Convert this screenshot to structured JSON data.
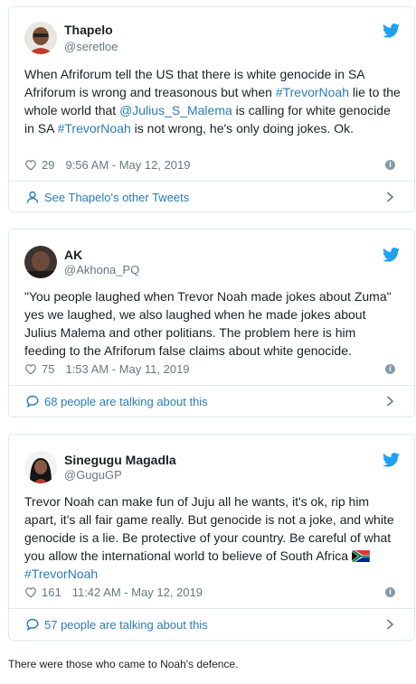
{
  "tweets": [
    {
      "name": "Thapelo",
      "handle": "@seretloe",
      "text_parts": {
        "p1": "When Afriforum tell the US that there is white genocide in SA Afriforum is wrong and treasonous but when ",
        "t1": "#TrevorNoah",
        "p2": " lie to the whole world that ",
        "t2": "@Julius_S_Malema",
        "p3": " is calling for white genocide in SA ",
        "t3": "#TrevorNoah",
        "p4": " is not wrong, he's only doing jokes. Ok."
      },
      "likes": "29",
      "timestamp": "9:56 AM - May 12, 2019",
      "footer": "See Thapelo's other Tweets"
    },
    {
      "name": "AK",
      "handle": "@Akhona_PQ",
      "text": "\"You people laughed  when Trevor Noah made jokes about Zuma\" yes we laughed, we also laughed when he made jokes about Julius Malema and other politians. The problem here is him feeding to the Afriforum false claims about white genocide.",
      "likes": "75",
      "timestamp": "1:53 AM - May 11, 2019",
      "footer": "68 people are talking about this"
    },
    {
      "name": "Sinegugu Magadla",
      "handle": "@GuguGP",
      "text_parts": {
        "p1": "Trevor Noah can make fun of Juju all he wants, it's ok, rip him apart, it's all fair game really. But genocide is not a joke, and white genocide is a lie. Be protective of your country. Be careful of what you allow the international world to believe of South Africa ",
        "t1": "#TrevorNoah"
      },
      "likes": "161",
      "timestamp": "11:42 AM - May 12, 2019",
      "footer": "57 people are talking about this"
    }
  ],
  "caption": "There were those who came to Noah's defence.",
  "colors": {
    "link": "#2b7bb9",
    "muted": "#697882",
    "border": "#e1e8ed",
    "twitter_blue": "#1da1f2"
  },
  "icons": [
    "twitter-bird-icon",
    "heart-icon",
    "info-icon",
    "person-icon",
    "speech-bubble-icon",
    "chevron-right-icon"
  ]
}
